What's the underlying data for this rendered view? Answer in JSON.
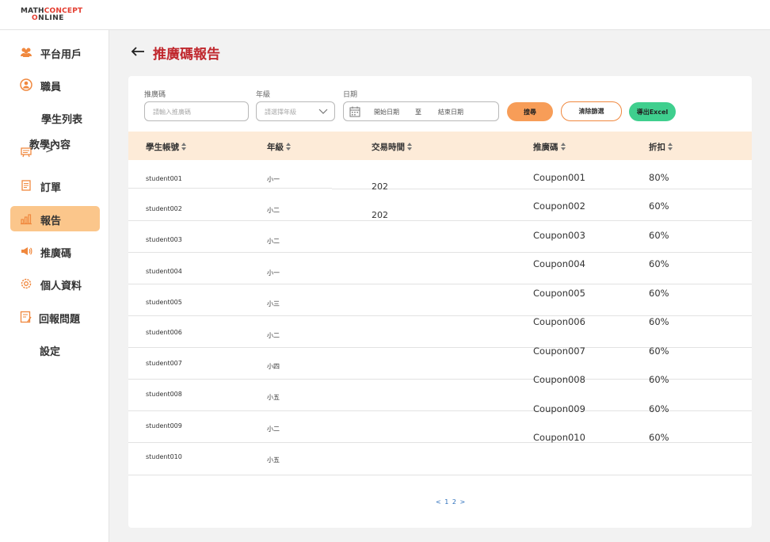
{
  "logo": {
    "line1a": "MATH",
    "line1b": "CONCEPT",
    "line2a": "O",
    "line2b": "NLINE"
  },
  "sidebar": {
    "items": [
      {
        "label": "平台用戶",
        "icon": "users-icon"
      },
      {
        "label": "職員",
        "icon": "user-circle-icon"
      },
      {
        "label": "學生列表",
        "icon": ""
      },
      {
        "label": "教學內容",
        "icon": "teaching-icon",
        "chevron": ">"
      },
      {
        "label": "訂單",
        "icon": "order-icon"
      },
      {
        "label": "報告",
        "icon": "report-chart-icon"
      },
      {
        "label": "推廣碼",
        "icon": "megaphone-icon"
      },
      {
        "label": "個人資料",
        "icon": "gear-icon"
      },
      {
        "label": "回報問題",
        "icon": "report-issue-icon"
      },
      {
        "label": "設定",
        "icon": ""
      }
    ]
  },
  "page": {
    "title": "推廣碼報告",
    "back_icon": "back-arrow-icon"
  },
  "filters": {
    "code_label": "推廣碼",
    "code_placeholder": "請輸入推廣碼",
    "grade_label": "年級",
    "grade_placeholder": "請選擇年級",
    "date_label": "日期",
    "date_start": "開始日期",
    "date_to": "至",
    "date_end": "結束日期",
    "search_btn": "搜尋",
    "clear_btn": "清除篩選",
    "export_btn": "導出Excel"
  },
  "table": {
    "headers": [
      "學生帳號",
      "年級",
      "交易時間",
      "推廣碼",
      "折扣"
    ],
    "rows": [
      {
        "account": "student001",
        "grade": "小一",
        "time": "202",
        "code": "Coupon001",
        "discount": "80%"
      },
      {
        "account": "student002",
        "grade": "小二",
        "time": "202",
        "code": "Coupon002",
        "discount": "60%"
      },
      {
        "account": "student003",
        "grade": "小二",
        "time": "",
        "code": "Coupon003",
        "discount": "60%"
      },
      {
        "account": "student004",
        "grade": "小一",
        "time": "",
        "code": "Coupon004",
        "discount": "60%"
      },
      {
        "account": "student005",
        "grade": "小三",
        "time": "",
        "code": "Coupon005",
        "discount": "60%"
      },
      {
        "account": "student006",
        "grade": "小二",
        "time": "",
        "code": "Coupon006",
        "discount": "60%"
      },
      {
        "account": "student007",
        "grade": "小四",
        "time": "",
        "code": "Coupon007",
        "discount": "60%"
      },
      {
        "account": "student008",
        "grade": "小五",
        "time": "",
        "code": "Coupon008",
        "discount": "60%"
      },
      {
        "account": "student009",
        "grade": "小二",
        "time": "",
        "code": "Coupon009",
        "discount": "60%"
      },
      {
        "account": "student010",
        "grade": "小五",
        "time": "",
        "code": "Coupon010",
        "discount": "60%"
      }
    ]
  },
  "pagination": {
    "text": "< 1 2 >"
  },
  "colors": {
    "accent": "#c0272d",
    "active_nav": "#fbc68b",
    "search_btn": "#f79d58",
    "export_btn": "#3fcf8e",
    "header_row": "#fdebd8"
  }
}
